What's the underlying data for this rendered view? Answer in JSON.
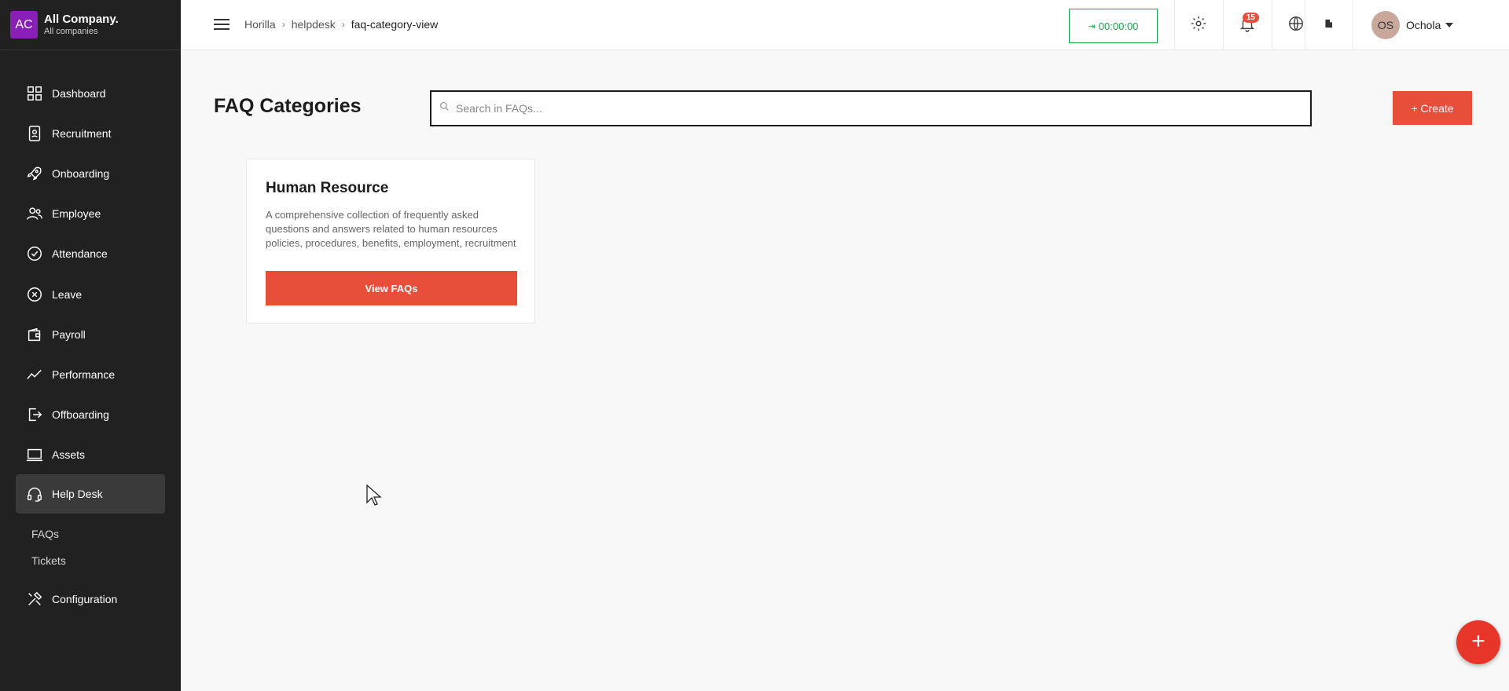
{
  "brand": {
    "logo_text": "AC",
    "name": "All Company.",
    "subtitle": "All companies",
    "logo_color": "#8a1fb8"
  },
  "sidebar": {
    "items": [
      {
        "label": "Dashboard",
        "icon": "grid-icon"
      },
      {
        "label": "Recruitment",
        "icon": "id-badge-icon"
      },
      {
        "label": "Onboarding",
        "icon": "rocket-icon"
      },
      {
        "label": "Employee",
        "icon": "users-icon"
      },
      {
        "label": "Attendance",
        "icon": "check-circle-icon"
      },
      {
        "label": "Leave",
        "icon": "x-circle-icon"
      },
      {
        "label": "Payroll",
        "icon": "wallet-icon"
      },
      {
        "label": "Performance",
        "icon": "trend-line-icon"
      },
      {
        "label": "Offboarding",
        "icon": "exit-icon"
      },
      {
        "label": "Assets",
        "icon": "laptop-icon"
      },
      {
        "label": "Help Desk",
        "icon": "headset-icon",
        "active": true
      },
      {
        "label": "Configuration",
        "icon": "tools-icon"
      }
    ],
    "helpdesk_sub": [
      "FAQs",
      "Tickets"
    ]
  },
  "header": {
    "breadcrumb": [
      "Horilla",
      "helpdesk",
      "faq-category-view"
    ],
    "timer": "00:00:00",
    "notification_count": "15",
    "user_initials": "OS",
    "user_name": "Ochola"
  },
  "main": {
    "title": "FAQ Categories",
    "search_placeholder": "Search in FAQs...",
    "create_label": "+ Create",
    "cards": [
      {
        "title": "Human Resource",
        "description": "A comprehensive collection of frequently asked questions and answers related to human resources policies, procedures, benefits, employment, recruitment and onboarding.",
        "button": "View FAQs"
      }
    ]
  },
  "fab_label": "+",
  "colors": {
    "accent": "#e84f3a",
    "sidebar_bg": "#212121",
    "timer_green": "#1aa34a"
  }
}
